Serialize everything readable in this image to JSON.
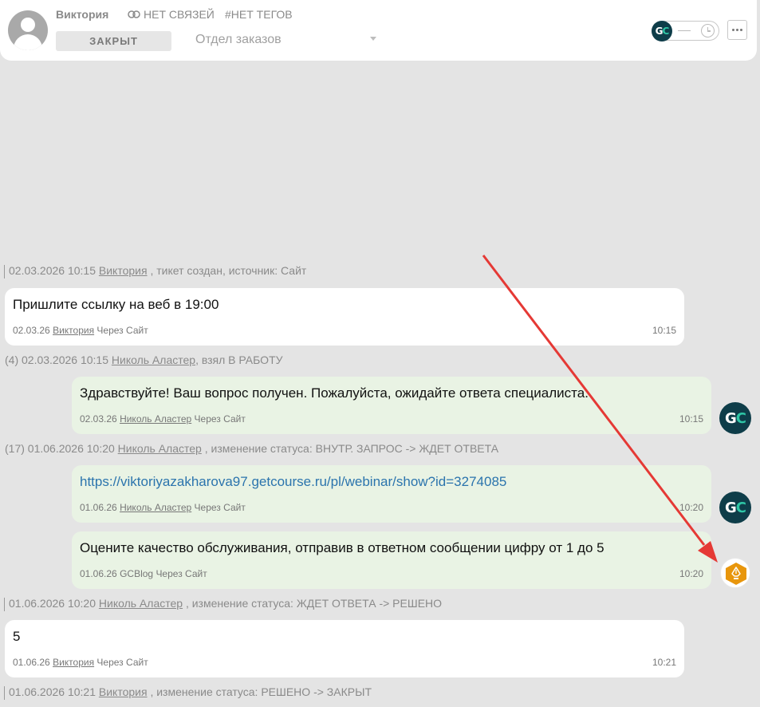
{
  "header": {
    "contact_name": "Виктория",
    "links": "НЕТ СВЯЗЕЙ",
    "tags": "#НЕТ ТЕГОВ",
    "status": "ЗАКРЫТ",
    "department": "Отдел заказов"
  },
  "events": [
    {
      "prefix": "02.03.2026 10:15",
      "user": "Виктория",
      "suffix": " , тикет создан, источник: Сайт"
    },
    {
      "prefix": "(4)  02.03.2026 10:15",
      "user": "Николь Аластер",
      "suffix": ", взял В РАБОТУ"
    },
    {
      "prefix": "(17)  01.06.2026 10:20",
      "user": "Николь Аластер",
      "suffix": " , изменение статуса: ВНУТР. ЗАПРОС -> ЖДЕТ ОТВЕТА"
    },
    {
      "prefix": "01.06.2026 10:20",
      "user": "Николь Аластер",
      "suffix": " , изменение статуса: ЖДЕТ ОТВЕТА -> РЕШЕНО"
    },
    {
      "prefix": "01.06.2026 10:21",
      "user": "Виктория",
      "suffix": " , изменение статуса: РЕШЕНО -> ЗАКРЫТ"
    }
  ],
  "messages": [
    {
      "text": "Пришлите ссылку на веб в 19:00",
      "date": "02.03.26",
      "author": "Виктория",
      "via": "Через Сайт",
      "time": "10:15"
    },
    {
      "text": "Здравствуйте! Ваш вопрос получен. Пожалуйста, ожидайте ответа специалиста.",
      "date": "02.03.26",
      "author": "Николь Аластер",
      "via": "Через Сайт",
      "time": "10:15"
    },
    {
      "text": "https://viktoriyazakharova97.getcourse.ru/pl/webinar/show?id=3274085",
      "date": "01.06.26",
      "author": "Николь Аластер",
      "via": "Через Сайт",
      "time": "10:20"
    },
    {
      "text": "Оцените качество обслуживания, отправив в ответном сообщении цифру от 1 до 5",
      "date": "01.06.26",
      "author": "GCBlog",
      "via": "Через Сайт",
      "time": "10:20"
    },
    {
      "text": "5",
      "date": "01.06.26",
      "author": "Виктория",
      "via": "Через Сайт",
      "time": "10:21"
    }
  ],
  "icons": {
    "gc_logo_left": "G",
    "gc_logo_right": "C",
    "brand_color": "#0e3d49",
    "accent_color": "#2ec6a6",
    "bot_color": "#e8960c",
    "arrow_color": "#e53935"
  }
}
